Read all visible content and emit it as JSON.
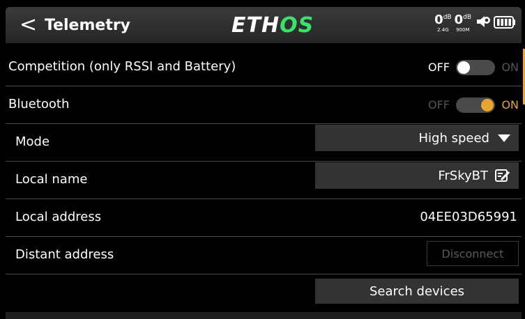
{
  "header": {
    "back_glyph": "<",
    "title": "Telemetry",
    "logo_part1": "ETH",
    "logo_part2": "OS",
    "signal_24": {
      "value": "0",
      "unit": "dB",
      "band": "2.4G"
    },
    "signal_900": {
      "value": "0",
      "unit": "dB",
      "band": "900M"
    },
    "icons": [
      "speaker-icon",
      "battery-icon"
    ]
  },
  "rows": {
    "competition": {
      "label": "Competition (only RSSI and Battery)",
      "off": "OFF",
      "on": "ON",
      "state": "off"
    },
    "bluetooth": {
      "label": "Bluetooth",
      "off": "OFF",
      "on": "ON",
      "state": "on"
    },
    "mode": {
      "label": "Mode",
      "value": "High speed"
    },
    "local_name": {
      "label": "Local name",
      "value": "FrSkyBT"
    },
    "local_address": {
      "label": "Local address",
      "value": "04EE03D65991"
    },
    "distant_address": {
      "label": "Distant address",
      "button": "Disconnect"
    },
    "search": {
      "button": "Search devices"
    }
  },
  "colors": {
    "accent": "#e8a531",
    "logo_green": "#39e36a",
    "field_bg": "#333333"
  }
}
